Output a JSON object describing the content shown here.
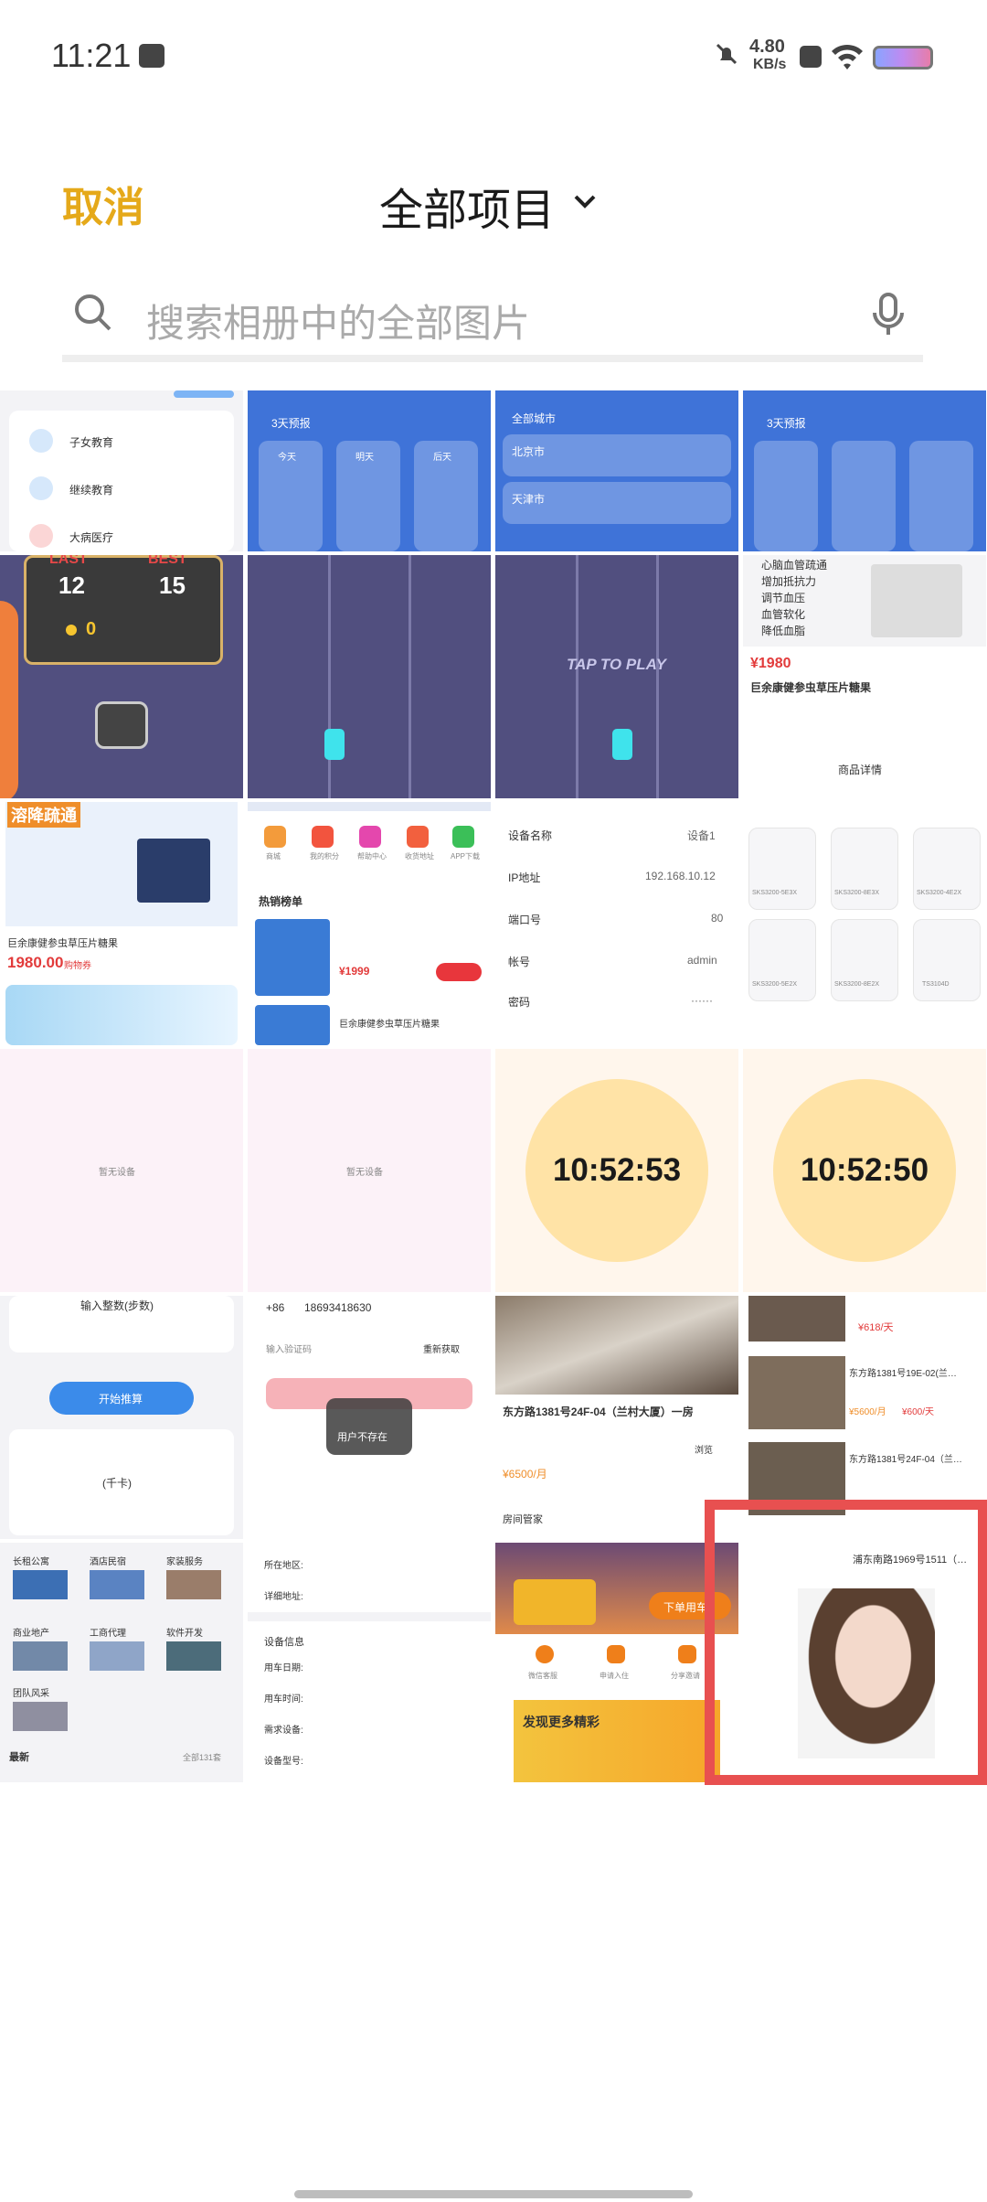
{
  "status": {
    "time": "11:21",
    "net_speed": "4.80",
    "net_unit": "KB/s"
  },
  "header": {
    "cancel": "取消",
    "title": "全部项目"
  },
  "search": {
    "placeholder": "搜索相册中的全部图片"
  },
  "thumbs": {
    "t1": {
      "items": [
        "子女教育",
        "继续教育",
        "大病医疗"
      ]
    },
    "t2": {
      "label": "3天预报",
      "days": [
        "今天",
        "明天",
        "后天"
      ]
    },
    "t3": {
      "label": "全部城市",
      "cities": [
        "北京市",
        "天津市"
      ]
    },
    "t4": {
      "label": "3天预报"
    },
    "t5": {
      "last": "LAST",
      "best": "BEST",
      "score1": "12",
      "score2": "15",
      "coins": "0"
    },
    "t7": {
      "tap": "TAP TO PLAY"
    },
    "t8": {
      "price": "¥1980",
      "name": "巨余康健参虫草压片糖果",
      "bullets": [
        "心脑血管疏通",
        "增加抵抗力",
        "调节血压",
        "血管软化",
        "降低血脂"
      ],
      "detail": "商品详情"
    },
    "t9": {
      "name": "巨余康健参虫草压片糖果",
      "price": "1980.00",
      "unit": "购物券",
      "headline": "溶降疏通"
    },
    "t10": {
      "icons": [
        "商城",
        "我的积分",
        "帮助中心",
        "收货地址",
        "APP下载"
      ],
      "hot": "热销榜单",
      "price": "¥1999",
      "product2": "巨余康健参虫草压片糖果"
    },
    "t11": {
      "rows": [
        [
          "设备名称",
          "设备1"
        ],
        [
          "IP地址",
          "192.168.10.12"
        ],
        [
          "端口号",
          "80"
        ],
        [
          "帐号",
          "admin"
        ],
        [
          "密码",
          "······"
        ]
      ]
    },
    "t12": {
      "models": [
        "SKS3200-5E3X",
        "SKS3200-8E3X",
        "SKS3200-4E2X",
        "SKS3200-5E2X",
        "SKS3200-8E2X",
        "TS3104D"
      ]
    },
    "t13": {
      "empty": "暂无设备"
    },
    "t14": {
      "empty": "暂无设备"
    },
    "t15": {
      "clock": "10:52:53"
    },
    "t16": {
      "clock": "10:52:50"
    },
    "t17": {
      "input": "输入整数(步数)",
      "button": "开始推算",
      "result": "(千卡)"
    },
    "t18": {
      "code": "+86",
      "phone": "18693418630",
      "verify": "输入验证码",
      "resend": "重新获取",
      "toast": "用户不存在"
    },
    "t19": {
      "title": "东方路1381号24F-04（兰村大厦）一房",
      "price": "¥6500/月",
      "bottom": "房间管家",
      "browse": "浏览"
    },
    "t20": {
      "items": [
        "东方路1381号19E-02(兰…",
        "东方路1381号24F-04（兰…"
      ],
      "price1": "¥618/天",
      "price2": "¥600/天",
      "price3": "¥5600/月"
    },
    "t21": {
      "tiles": [
        "长租公寓",
        "酒店民宿",
        "家装服务",
        "商业地产",
        "工商代理",
        "软件开发",
        "团队风采"
      ],
      "latest": "最新",
      "all": "全部131套"
    },
    "t22": {
      "rows": [
        "所在地区:",
        "详细地址:",
        "用车日期:",
        "用车时间:",
        "需求设备:",
        "设备型号:"
      ],
      "section": "设备信息"
    },
    "t23": {
      "button": "下单用车",
      "banner": "发现更多精彩",
      "icons": [
        "微信客服",
        "申请入住",
        "分享邀请"
      ]
    },
    "t24": {
      "title": "浦东南路1969号1511（…"
    }
  }
}
